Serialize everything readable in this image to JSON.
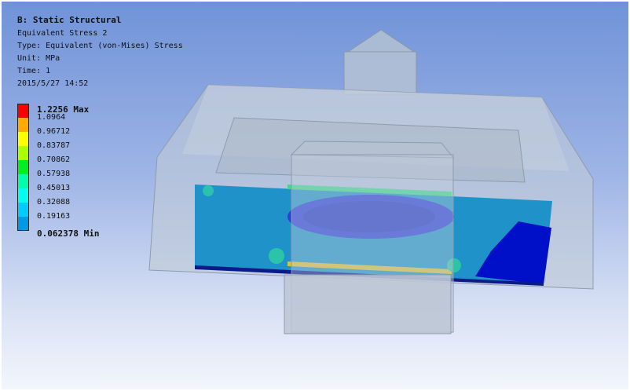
{
  "header": {
    "analysis": "B: Static Structural",
    "result_name": "Equivalent Stress 2",
    "type_line": "Type: Equivalent (von-Mises) Stress",
    "unit_line": "Unit: MPa",
    "time_line": "Time: 1",
    "timestamp": "2015/5/27 14:52"
  },
  "legend": {
    "labels": [
      "1.2256 Max",
      "1.0964",
      "0.96712",
      "0.83787",
      "0.70862",
      "0.57938",
      "0.45013",
      "0.32088",
      "0.19163",
      "0.062378 Min"
    ],
    "colors": [
      "#ff0000",
      "#ffaa00",
      "#ffff00",
      "#aaff00",
      "#00ee22",
      "#00ffaa",
      "#00ffee",
      "#00ccff",
      "#0099e6",
      "#0000ff"
    ]
  }
}
